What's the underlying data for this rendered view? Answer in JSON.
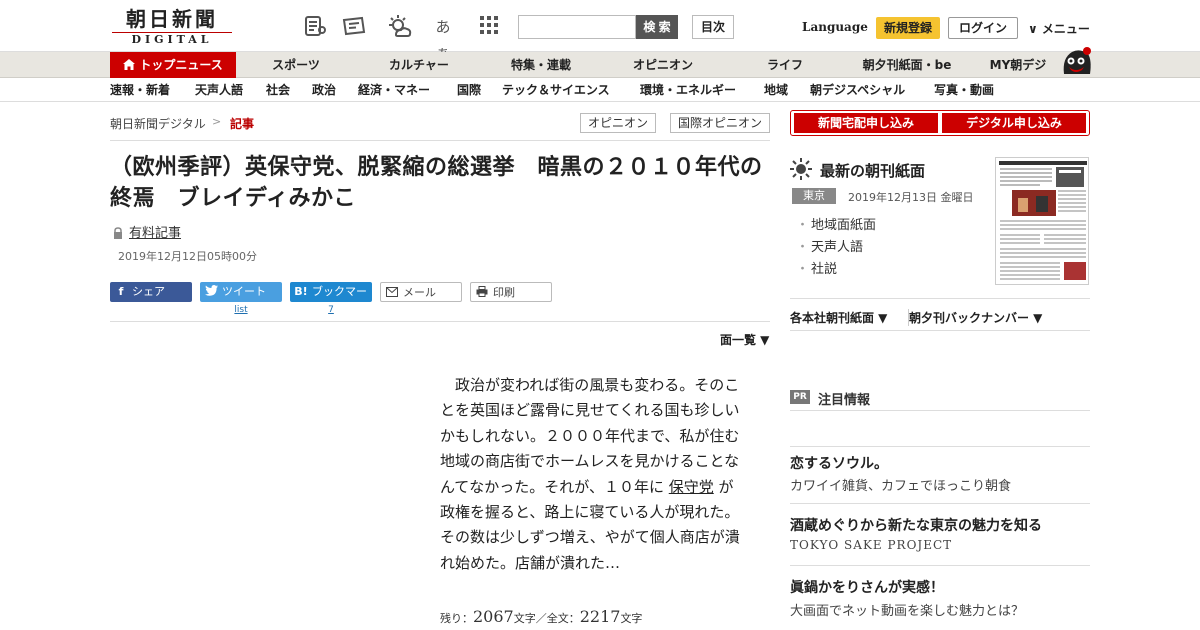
{
  "header": {
    "logo_jp": "朝日新聞",
    "logo_en": "DIGITAL",
    "search_button": "検 索",
    "search_placeholder": "",
    "mokuji": "目次",
    "language": "Language",
    "register": "新規登録",
    "login": "ログイン",
    "menu": "∨ メニュー",
    "aa_label": "あぁ"
  },
  "nav": [
    {
      "label": "トップニュース",
      "active": true
    },
    {
      "label": "スポーツ"
    },
    {
      "label": "カルチャー"
    },
    {
      "label": "特集・連載"
    },
    {
      "label": "オピニオン"
    },
    {
      "label": "ライフ"
    },
    {
      "label": "朝夕刊紙面・be"
    },
    {
      "label": "MY朝デジ"
    }
  ],
  "subnav": [
    "速報・新着",
    "天声人語",
    "社会",
    "政治",
    "経済・マネー",
    "国際",
    "テック＆サイエンス",
    "環境・エネルギー",
    "地域",
    "朝デジスペシャル",
    "写真・動画"
  ],
  "breadcrumb": {
    "home": "朝日新聞デジタル",
    "sep": ">",
    "current": "記事"
  },
  "tags": [
    "オピニオン",
    "国際オピニオン"
  ],
  "article": {
    "title": "（欧州季評）英保守党、脱緊縮の総選挙　暗黒の２０１０年代の終焉　ブレイディみかこ",
    "paid": "有料記事",
    "date": "2019年12月12日05時00分",
    "share_fb": "シェア",
    "share_tw": "ツイート",
    "share_hb": "ブックマーク",
    "share_mail": "メール",
    "share_print": "印刷",
    "tw_count": "list",
    "hb_count": "7",
    "menmenu": "面一覧 ▼",
    "body_before": "政治が変われば街の風景も変わる。そのことを英国ほど露骨に見せてくれる国も珍しいかもしれない。２０００年代まで、私が住む地域の商店街でホームレスを見かけることなんてなかった。それが、１０年に ",
    "body_keyword": "保守党",
    "body_after": " が政権を握ると、路上に寝ている人が現れた。その数は少しずつ増え、やがて個人商店が潰れ始めた。店舗が潰れた…",
    "remain_label": "残り：",
    "remain_count": "2067",
    "remain_unit": "文字／全文：",
    "total_count": "2217",
    "total_unit": "文字"
  },
  "sidebar": {
    "delivery": "新聞宅配申し込み",
    "digital": "デジタル申し込み",
    "paper_title": "最新の朝刊紙面",
    "city": "東京",
    "paper_date": "2019年12月13日 金曜日",
    "paper_links": [
      "地域面紙面",
      "天声人語",
      "社説"
    ],
    "dropdown1": "各本社朝刊紙面 ▼",
    "dropdown2": "朝夕刊バックナンバー ▼",
    "pr_badge": "PR",
    "pr_title": "注目情報",
    "pr_items": [
      {
        "head": "恋するソウル。",
        "sub": "カワイイ雑貨、カフェでほっこり朝食"
      },
      {
        "head": "酒蔵めぐりから新たな東京の魅力を知る",
        "sub": "TOKYO SAKE PROJECT"
      },
      {
        "head": "眞鍋かをりさんが実感！",
        "sub": "大画面でネット動画を楽しむ魅力とは？"
      }
    ]
  },
  "colors": {
    "brand_red": "#cc0000",
    "register_yellow": "#f5c330",
    "nav_bg": "#e8e6e0",
    "fb_blue": "#3b5998",
    "tw_blue": "#4a9fe0",
    "hb_blue": "#1e88d0"
  }
}
